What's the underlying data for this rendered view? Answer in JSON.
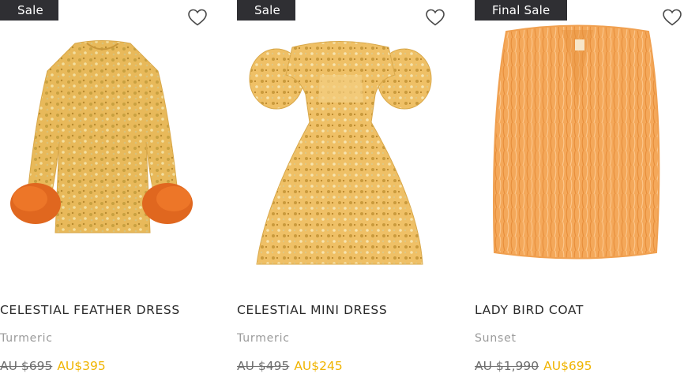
{
  "colors": {
    "badge_bg": "#2f2f33",
    "sale_price": "#f0b400",
    "old_price": "#6e6e6e",
    "variant_text": "#9a9a9a"
  },
  "products": [
    {
      "badge": "Sale",
      "name": "CELESTIAL FEATHER DRESS",
      "color": "Turmeric",
      "old_price": "AU $695",
      "price": "AU$395",
      "icon": "heart-icon"
    },
    {
      "badge": "Sale",
      "name": "CELESTIAL MINI DRESS",
      "color": "Turmeric",
      "old_price": "AU $495",
      "price": "AU$245",
      "icon": "heart-icon"
    },
    {
      "badge": "Final Sale",
      "name": "LADY BIRD COAT",
      "color": "Sunset",
      "old_price": "AU $1,990",
      "price": "AU$695",
      "icon": "heart-icon"
    }
  ]
}
